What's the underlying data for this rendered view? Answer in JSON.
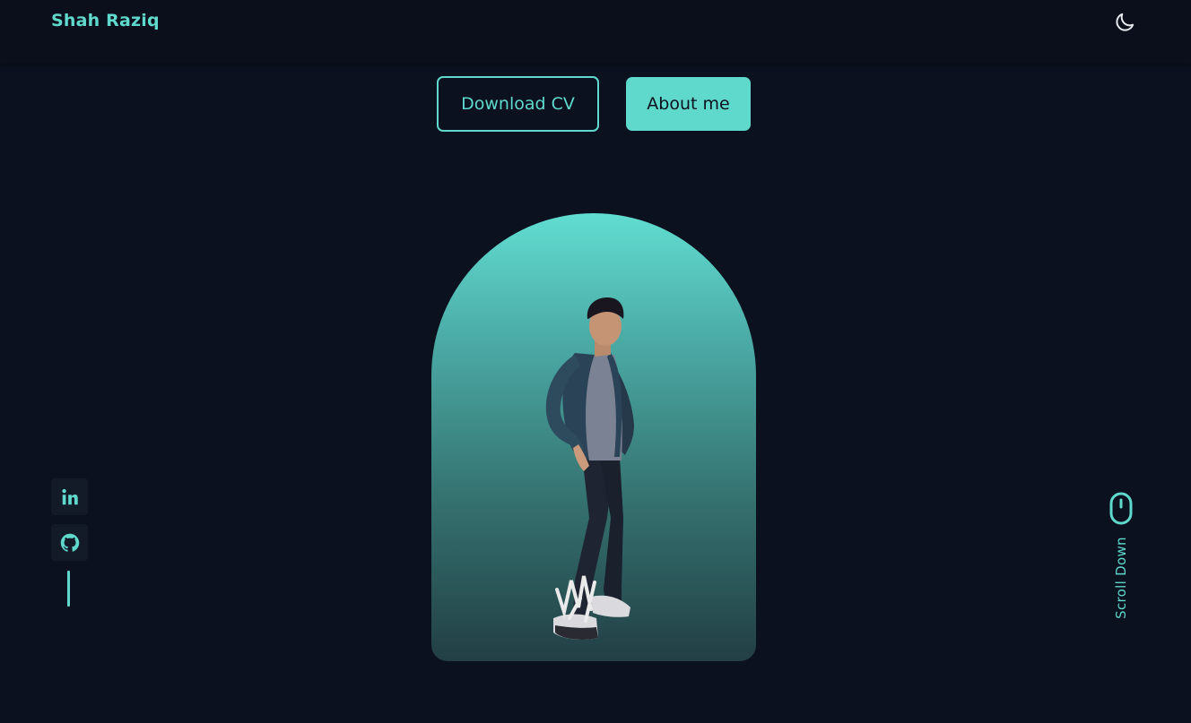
{
  "header": {
    "logo": "Shah Raziq",
    "theme_icon": "moon-icon"
  },
  "hero": {
    "download_cv_label": "Download CV",
    "about_me_label": "About me",
    "portrait_alt": "portrait of a person standing"
  },
  "social": {
    "items": [
      {
        "icon": "linkedin-icon"
      },
      {
        "icon": "github-icon"
      }
    ]
  },
  "scroll": {
    "label": "Scroll Down",
    "icon": "mouse-icon"
  },
  "colors": {
    "accent": "#5fd9cc",
    "background": "#0b111e",
    "header_bg": "#0a0f1b",
    "social_bg": "#141b28"
  }
}
